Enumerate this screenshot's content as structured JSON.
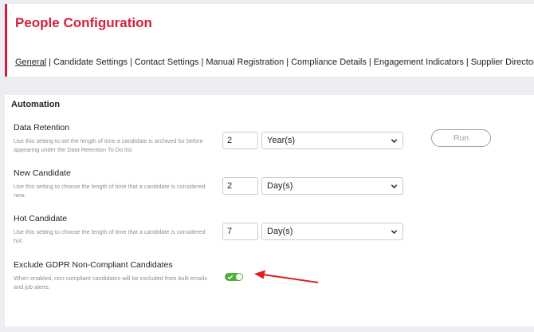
{
  "header": {
    "title": "People Configuration",
    "nav": [
      {
        "label": "General",
        "active": true
      },
      {
        "label": "Candidate Settings"
      },
      {
        "label": "Contact Settings"
      },
      {
        "label": "Manual Registration"
      },
      {
        "label": "Compliance Details"
      },
      {
        "label": "Engagement Indicators"
      },
      {
        "label": "Supplier Directory"
      }
    ],
    "separator": "|"
  },
  "automation": {
    "title": "Automation",
    "data_retention": {
      "title": "Data Retention",
      "description": "Use this setting to set the length of time a candidate is archived for before appearing under the Data Retention To Do list.",
      "value": "2",
      "unit": "Year(s)"
    },
    "new_candidate": {
      "title": "New Candidate",
      "description": "Use this setting to choose the length of time that a candidate is considered new.",
      "value": "2",
      "unit": "Day(s)"
    },
    "hot_candidate": {
      "title": "Hot Candidate",
      "description": "Use this setting to choose the length of time that a candidate is considered hot.",
      "value": "7",
      "unit": "Day(s)"
    },
    "gdpr": {
      "title": "Exclude GDPR Non-Compliant Candidates",
      "description": "When enabled, non-compliant candidates will be excluded from bulk emails and job alerts.",
      "enabled": true
    },
    "run_label": "Run"
  },
  "colors": {
    "accent": "#d61f3c",
    "toggle_on": "#4caf3a",
    "annotation_arrow": "#e0201f"
  },
  "icons": {
    "select_chevron": "chevron-down-icon",
    "toggle_check": "check-icon",
    "annotation": "arrow-icon"
  }
}
